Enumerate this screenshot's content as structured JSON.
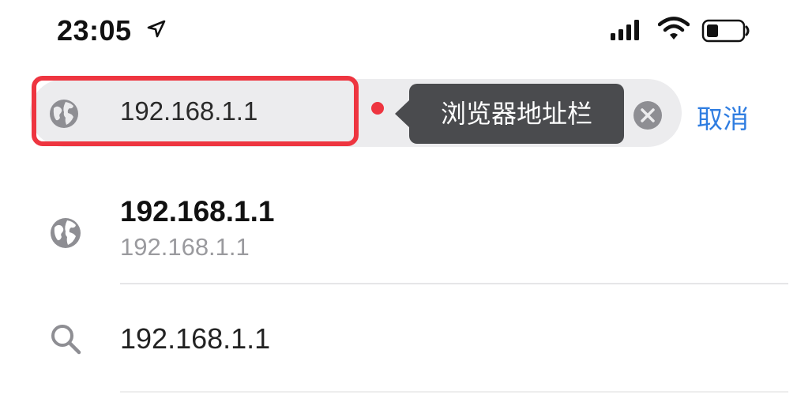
{
  "status_bar": {
    "time": "23:05",
    "icons": [
      "location-arrow-icon",
      "signal-icon",
      "wifi-icon",
      "battery-icon"
    ]
  },
  "address_bar": {
    "value": "192.168.1.1",
    "tooltip": "浏览器地址栏",
    "cancel_label": "取消",
    "highlight_color": "#ee3540",
    "icons": [
      "globe-icon",
      "clear-icon"
    ]
  },
  "suggestions": [
    {
      "type": "site",
      "icon": "globe-icon",
      "title": "192.168.1.1",
      "subtitle": "192.168.1.1"
    },
    {
      "type": "search",
      "icon": "search-icon",
      "query": "192.168.1.1"
    }
  ],
  "colors": {
    "accent": "#2f7de1",
    "highlight": "#ee3540",
    "tooltip_bg": "#4a4b4e",
    "field_bg": "#ececee"
  }
}
